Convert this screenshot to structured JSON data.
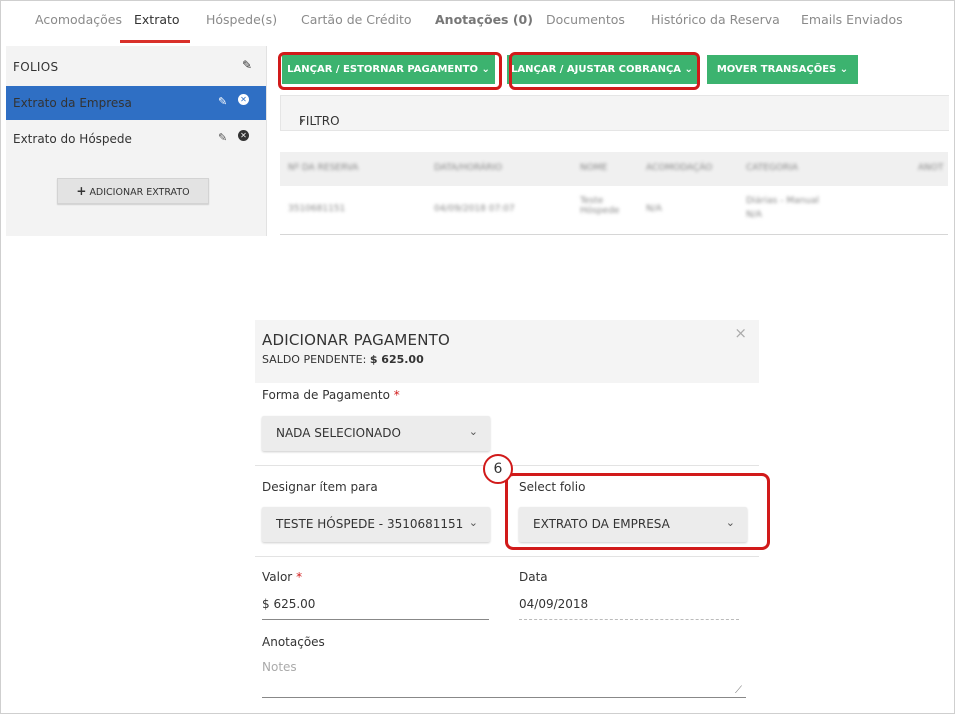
{
  "tabs": [
    {
      "label": "Acomodações"
    },
    {
      "label": "Extrato"
    },
    {
      "label": "Hóspede(s)"
    },
    {
      "label": "Cartão de Crédito"
    },
    {
      "label": "Anotações (0)"
    },
    {
      "label": "Documentos"
    },
    {
      "label": "Histórico da Reserva"
    },
    {
      "label": "Emails Enviados"
    }
  ],
  "sidebar": {
    "title": "FOLIOS",
    "folios": [
      {
        "label": "Extrato da Empresa"
      },
      {
        "label": "Extrato do Hóspede"
      }
    ],
    "add_label": "ADICIONAR EXTRATO"
  },
  "actions": {
    "payment_label": "LANÇAR / ESTORNAR PAGAMENTO",
    "charge_label": "LANÇAR / AJUSTAR COBRANÇA",
    "move_label": "MOVER TRANSAÇÕES"
  },
  "filter": {
    "label": "FILTRO"
  },
  "table": {
    "headers": [
      "Nº DA RESERVA",
      "DATA/HORÁRIO",
      "NOME",
      "ACOMODAÇÃO",
      "CATEGORIA",
      "ANOT"
    ],
    "row": [
      "3510681151",
      "04/09/2018 07:07",
      "Teste Hóspede",
      "N/A",
      "Diárias - Manual",
      "N/A"
    ]
  },
  "modal": {
    "title": "ADICIONAR PAGAMENTO",
    "balance_label": "SALDO PENDENTE:",
    "balance_value": "$ 625.00",
    "payment_method_label": "Forma de Pagamento",
    "payment_method_value": "NADA SELECIONADO",
    "assign_label": "Designar ítem para",
    "assign_value": "TESTE HÓSPEDE - 3510681151",
    "folio_label": "Select folio",
    "folio_value": "EXTRATO DA EMPRESA",
    "amount_label": "Valor",
    "amount_value": "$ 625.00",
    "date_label": "Data",
    "date_value": "04/09/2018",
    "notes_label": "Anotações",
    "notes_placeholder": "Notes",
    "step_badge": "6"
  },
  "colors": {
    "accent_green": "#3cb36f",
    "active_blue": "#2f6fc4",
    "highlight_red": "#d11a1a",
    "tab_underline": "#d9302a"
  }
}
